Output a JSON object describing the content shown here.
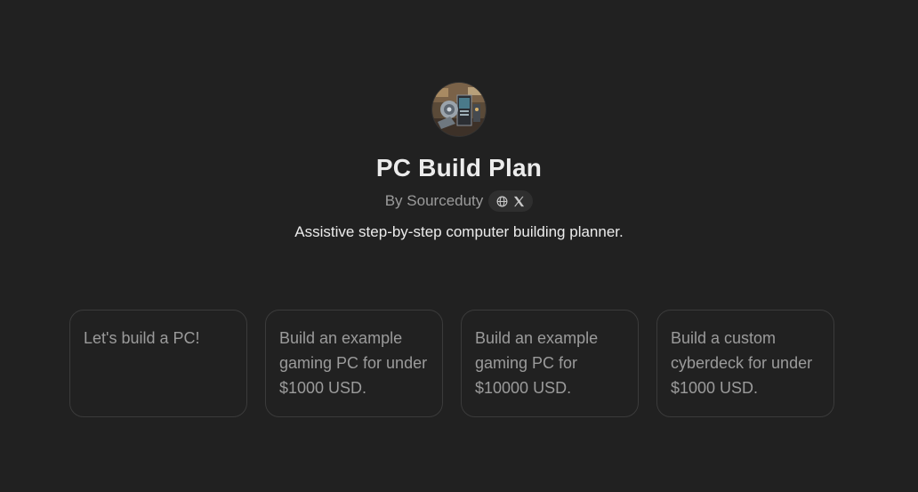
{
  "gpt": {
    "avatar_icon": "pc-build-avatar-icon",
    "name": "PC Build Plan",
    "byline": "By Sourceduty",
    "links": [
      {
        "icon": "globe-icon"
      },
      {
        "icon": "x-logo-icon"
      }
    ],
    "description": "Assistive step-by-step computer building planner."
  },
  "starters": [
    {
      "label": "Let's build a PC!"
    },
    {
      "label": "Build an example gaming PC for under $1000 USD."
    },
    {
      "label": "Build an example gaming PC for $10000 USD."
    },
    {
      "label": "Build a custom cyberdeck for under $1000 USD."
    }
  ],
  "colors": {
    "background": "#212121",
    "title_text": "#ececec",
    "muted_text": "#9b9b9b",
    "card_border": "#3b3b3b",
    "badge_background": "#2f2f2f"
  }
}
